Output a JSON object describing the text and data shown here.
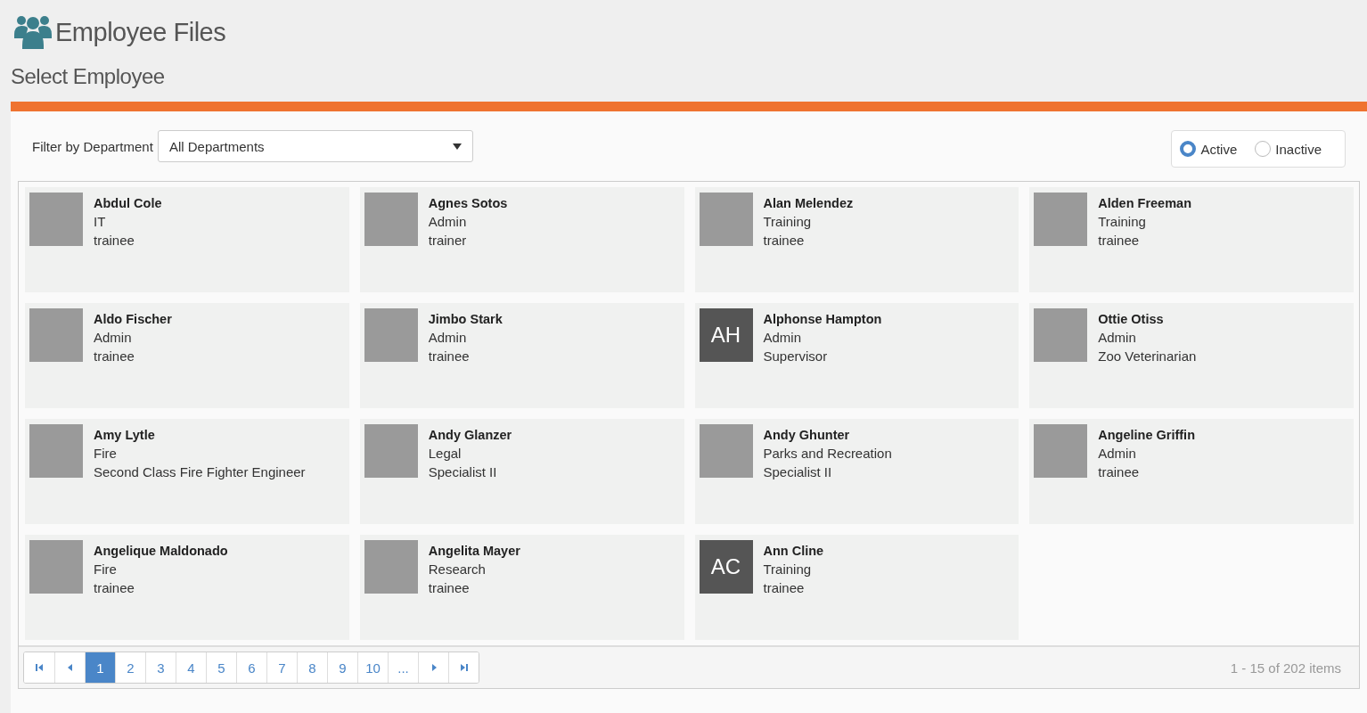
{
  "app": {
    "title": "Employee Files"
  },
  "page_title": "Select Employee",
  "filter": {
    "label": "Filter by Department",
    "value": "All Departments"
  },
  "status_options": [
    {
      "label": "Active",
      "selected": true
    },
    {
      "label": "Inactive",
      "selected": false
    }
  ],
  "employees": [
    {
      "name": "Abdul Cole",
      "department": "IT",
      "role": "trainee",
      "kind": "photo"
    },
    {
      "name": "Agnes Sotos",
      "department": "Admin",
      "role": "trainer",
      "kind": "photo"
    },
    {
      "name": "Alan Melendez",
      "department": "Training",
      "role": "trainee",
      "kind": "photo"
    },
    {
      "name": "Alden Freeman",
      "department": "Training",
      "role": "trainee",
      "kind": "photo"
    },
    {
      "name": "Aldo Fischer",
      "department": "Admin",
      "role": "trainee",
      "kind": "photo"
    },
    {
      "name": "Jimbo Stark",
      "department": "Admin",
      "role": "trainee",
      "kind": "photo"
    },
    {
      "name": "Alphonse Hampton",
      "department": "Admin",
      "role": "Supervisor",
      "kind": "initials",
      "initials": "AH"
    },
    {
      "name": "Ottie Otiss",
      "department": "Admin",
      "role": "Zoo Veterinarian",
      "kind": "photo"
    },
    {
      "name": "Amy Lytle",
      "department": "Fire",
      "role": "Second Class Fire Fighter Engineer",
      "kind": "photo"
    },
    {
      "name": "Andy Glanzer",
      "department": "Legal",
      "role": "Specialist II",
      "kind": "photo"
    },
    {
      "name": "Andy Ghunter",
      "department": "Parks and Recreation",
      "role": "Specialist II",
      "kind": "photo"
    },
    {
      "name": "Angeline Griffin",
      "department": "Admin",
      "role": "trainee",
      "kind": "photo"
    },
    {
      "name": "Angelique Maldonado",
      "department": "Fire",
      "role": "trainee",
      "kind": "photo"
    },
    {
      "name": "Angelita Mayer",
      "department": "Research",
      "role": "trainee",
      "kind": "photo"
    },
    {
      "name": "Ann Cline",
      "department": "Training",
      "role": "trainee",
      "kind": "initials",
      "initials": "AC"
    }
  ],
  "pager": {
    "pages": [
      {
        "label": "1",
        "selected": true
      },
      {
        "label": "2",
        "selected": false
      },
      {
        "label": "3",
        "selected": false
      },
      {
        "label": "4",
        "selected": false
      },
      {
        "label": "5",
        "selected": false
      },
      {
        "label": "6",
        "selected": false
      },
      {
        "label": "7",
        "selected": false
      },
      {
        "label": "8",
        "selected": false
      },
      {
        "label": "9",
        "selected": false
      },
      {
        "label": "10",
        "selected": false
      },
      {
        "label": "...",
        "selected": false
      }
    ],
    "summary": "1 - 15 of 202 items"
  }
}
